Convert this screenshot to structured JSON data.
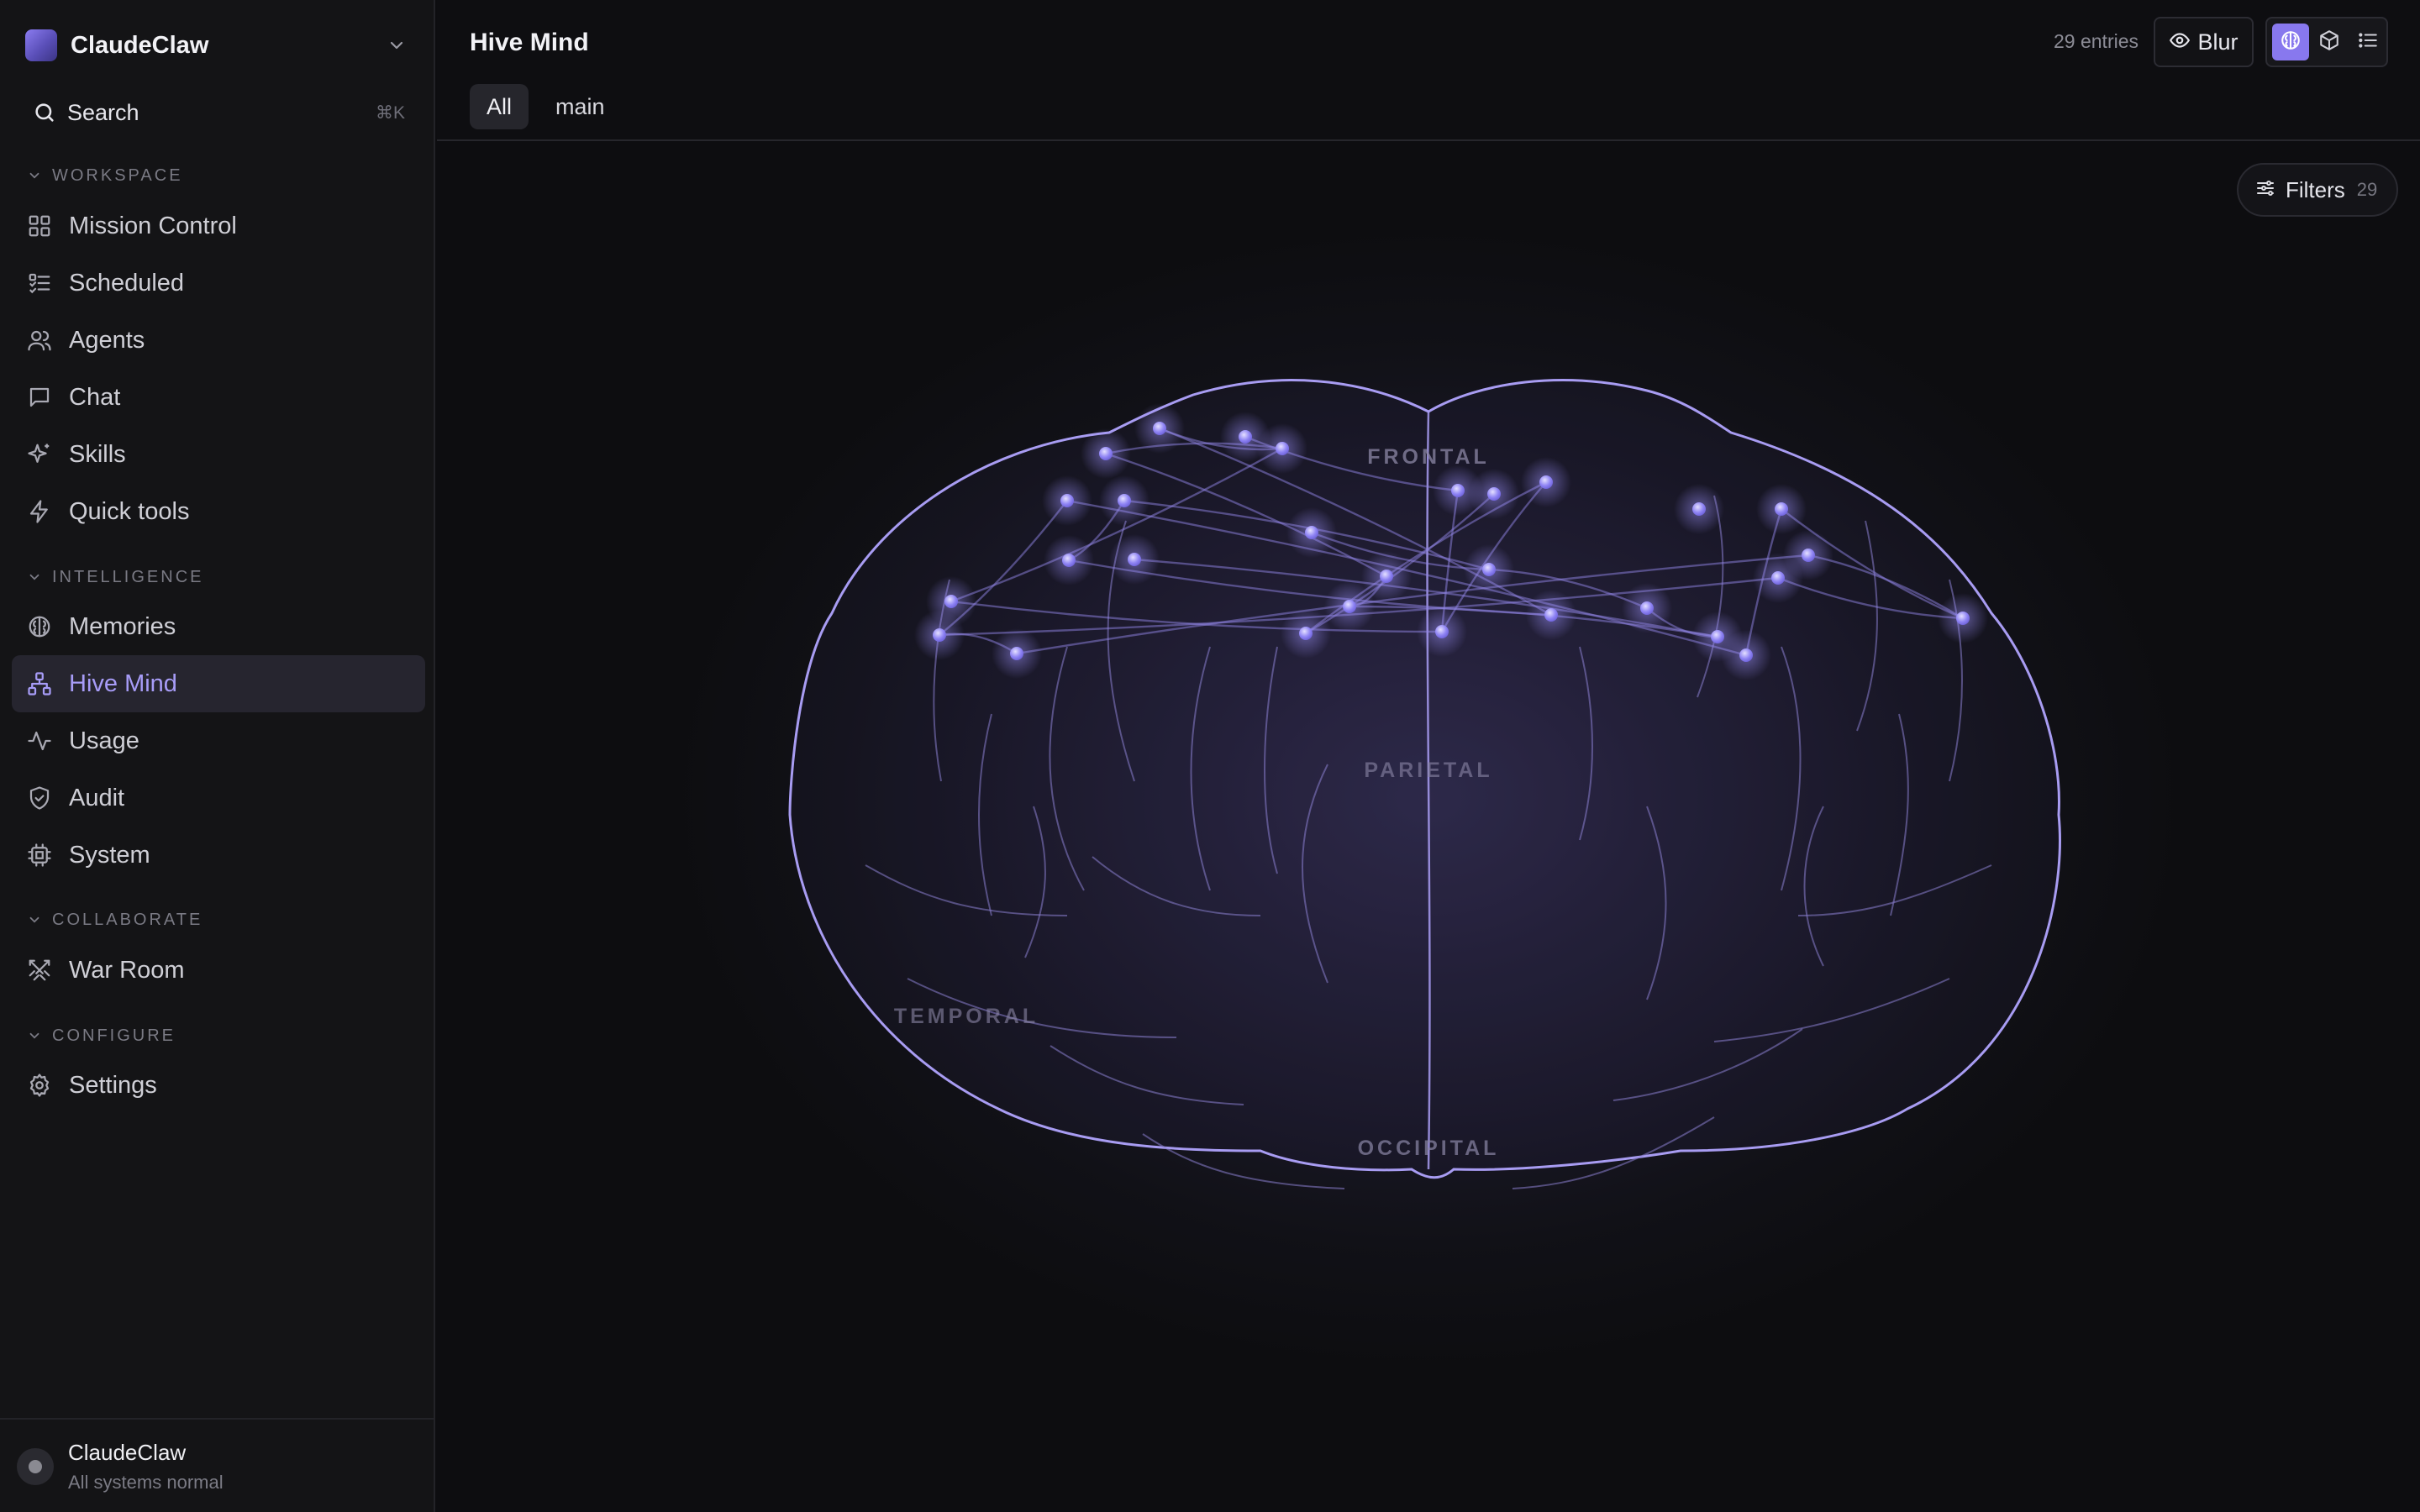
{
  "app": {
    "name": "ClaudeClaw"
  },
  "search": {
    "label": "Search",
    "shortcut": "⌘K"
  },
  "sections": {
    "workspace": "WORKSPACE",
    "intelligence": "INTELLIGENCE",
    "collaborate": "COLLABORATE",
    "configure": "CONFIGURE"
  },
  "nav": {
    "mission_control": "Mission Control",
    "scheduled": "Scheduled",
    "agents": "Agents",
    "chat": "Chat",
    "skills": "Skills",
    "quick_tools": "Quick tools",
    "memories": "Memories",
    "hive_mind": "Hive Mind",
    "usage": "Usage",
    "audit": "Audit",
    "system": "System",
    "war_room": "War Room",
    "settings": "Settings"
  },
  "footer": {
    "name": "ClaudeClaw",
    "status": "All systems normal"
  },
  "header": {
    "title": "Hive Mind",
    "tabs": [
      "All",
      "main"
    ],
    "active_tab": "All",
    "entries": "29 entries",
    "blur_label": "Blur",
    "view_modes": [
      "brain",
      "cube",
      "list"
    ],
    "active_view": "brain"
  },
  "filters": {
    "label": "Filters",
    "count": "29"
  },
  "brain": {
    "regions": {
      "frontal": "FRONTAL",
      "parietal": "PARIETAL",
      "temporal": "TEMPORAL",
      "occipital": "OCCIPITAL"
    },
    "node_count": 29,
    "colors": {
      "outline": "#a89cf2",
      "node": "#8f84f4",
      "accent": "#8878ee"
    }
  }
}
